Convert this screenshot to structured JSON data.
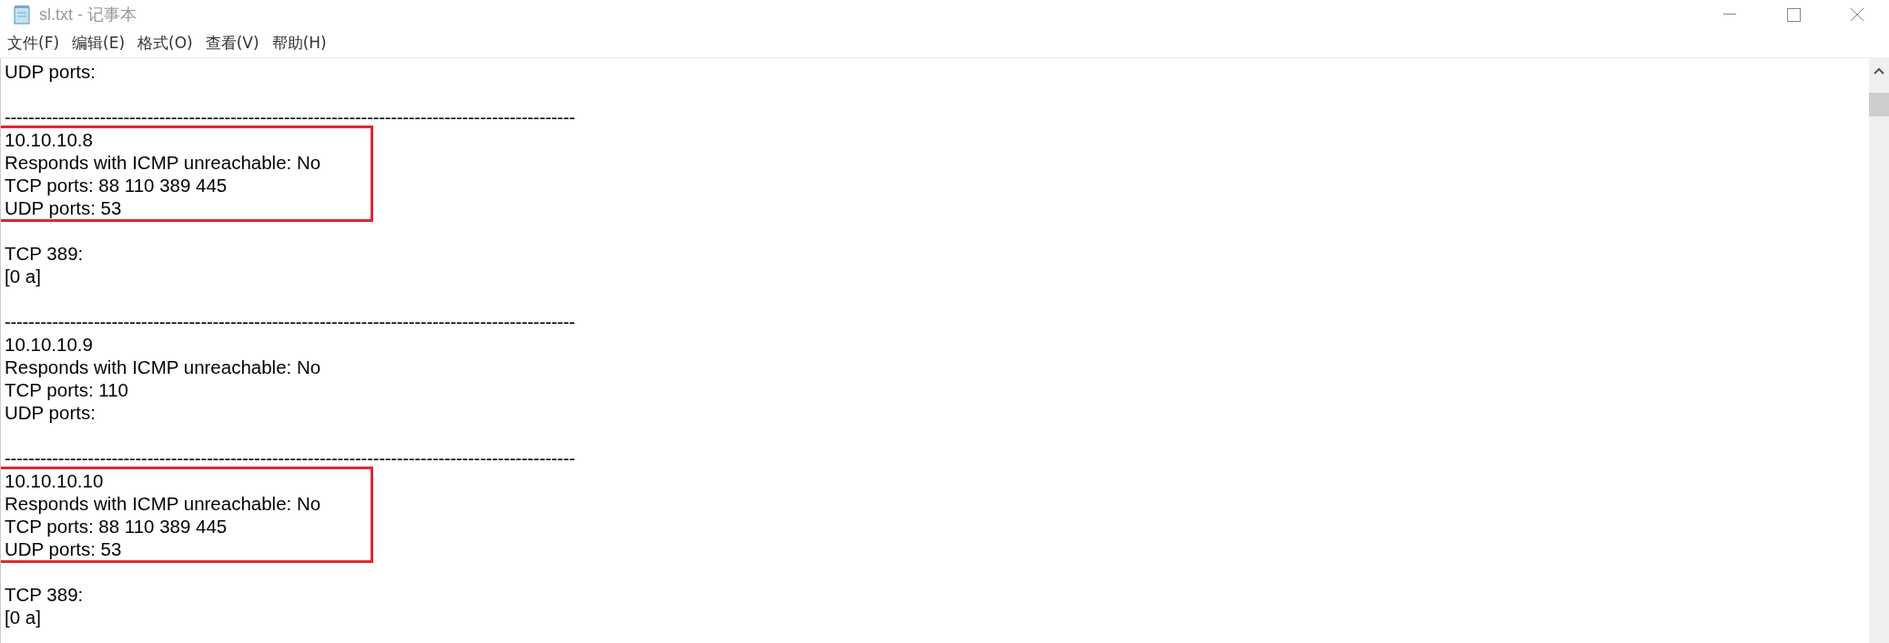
{
  "window": {
    "title": "sl.txt - 记事本"
  },
  "menu": [
    {
      "label": "文件(F)"
    },
    {
      "label": "编辑(E)"
    },
    {
      "label": "格式(O)"
    },
    {
      "label": "查看(V)"
    },
    {
      "label": "帮助(H)"
    }
  ],
  "document": [
    {
      "kind": "line",
      "text": "UDP ports:"
    },
    {
      "kind": "blank"
    },
    {
      "kind": "rule",
      "text": "------------------------------------------------------------------------------------------------"
    },
    {
      "kind": "box",
      "lines": [
        "10.10.10.8",
        "Responds with ICMP unreachable: No",
        "TCP ports: 88 110 389 445",
        "UDP ports: 53"
      ]
    },
    {
      "kind": "blank"
    },
    {
      "kind": "line",
      "text": "TCP 389:"
    },
    {
      "kind": "line",
      "text": "[0 a]"
    },
    {
      "kind": "blank"
    },
    {
      "kind": "rule",
      "text": "------------------------------------------------------------------------------------------------"
    },
    {
      "kind": "line",
      "text": "10.10.10.9"
    },
    {
      "kind": "line",
      "text": "Responds with ICMP unreachable: No"
    },
    {
      "kind": "line",
      "text": "TCP ports: 110"
    },
    {
      "kind": "line",
      "text": "UDP ports:"
    },
    {
      "kind": "blank"
    },
    {
      "kind": "rule",
      "text": "------------------------------------------------------------------------------------------------"
    },
    {
      "kind": "box",
      "lines": [
        "10.10.10.10",
        "Responds with ICMP unreachable: No",
        "TCP ports: 88 110 389 445",
        "UDP ports: 53"
      ]
    },
    {
      "kind": "blank"
    },
    {
      "kind": "line",
      "text": "TCP 389:"
    },
    {
      "kind": "line",
      "text": "[0 a]"
    }
  ]
}
